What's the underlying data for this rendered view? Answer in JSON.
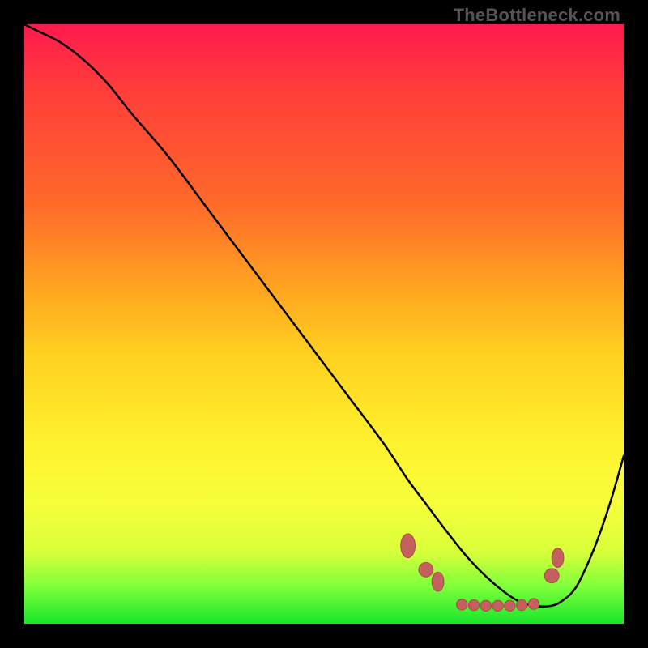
{
  "watermark": "TheBottleneck.com",
  "colors": {
    "background": "#000000",
    "gradient_top": "#ff1a4d",
    "gradient_mid1": "#ff6a2a",
    "gradient_mid2": "#fff22e",
    "gradient_bottom": "#17e62a",
    "curve": "#000000",
    "marker_fill": "#c4615f",
    "marker_stroke": "#aa4c4a"
  },
  "chart_data": {
    "type": "line",
    "title": "",
    "xlabel": "",
    "ylabel": "",
    "xlim": [
      0,
      100
    ],
    "ylim": [
      0,
      100
    ],
    "grid": false,
    "legend": false,
    "series": [
      {
        "name": "curve",
        "x": [
          0,
          2,
          6,
          10,
          14,
          18,
          24,
          30,
          36,
          42,
          48,
          54,
          60,
          64,
          67,
          70,
          74,
          78,
          82,
          85,
          88,
          90,
          92,
          94,
          96,
          98,
          100
        ],
        "y": [
          100,
          99,
          97,
          94,
          90,
          85,
          78,
          70,
          62,
          54,
          46,
          38,
          30,
          24,
          20,
          16,
          11,
          7,
          4,
          3,
          3,
          4,
          6,
          10,
          15,
          21,
          28
        ]
      }
    ],
    "markers": [
      {
        "x": 64,
        "y": 13,
        "shape": "ellipse",
        "rx": 1.2,
        "ry": 2.0
      },
      {
        "x": 67,
        "y": 9,
        "shape": "circle",
        "r": 1.2
      },
      {
        "x": 69,
        "y": 7,
        "shape": "ellipse",
        "rx": 1.0,
        "ry": 1.6
      },
      {
        "x": 73,
        "y": 3.2,
        "shape": "circle",
        "r": 0.9
      },
      {
        "x": 75,
        "y": 3.1,
        "shape": "circle",
        "r": 0.9
      },
      {
        "x": 77,
        "y": 3.0,
        "shape": "circle",
        "r": 0.9
      },
      {
        "x": 79,
        "y": 3.0,
        "shape": "circle",
        "r": 0.9
      },
      {
        "x": 81,
        "y": 3.0,
        "shape": "circle",
        "r": 0.9
      },
      {
        "x": 83,
        "y": 3.1,
        "shape": "circle",
        "r": 0.9
      },
      {
        "x": 85,
        "y": 3.3,
        "shape": "circle",
        "r": 0.9
      },
      {
        "x": 88,
        "y": 8,
        "shape": "circle",
        "r": 1.2
      },
      {
        "x": 89,
        "y": 11,
        "shape": "ellipse",
        "rx": 1.0,
        "ry": 1.6
      }
    ]
  }
}
